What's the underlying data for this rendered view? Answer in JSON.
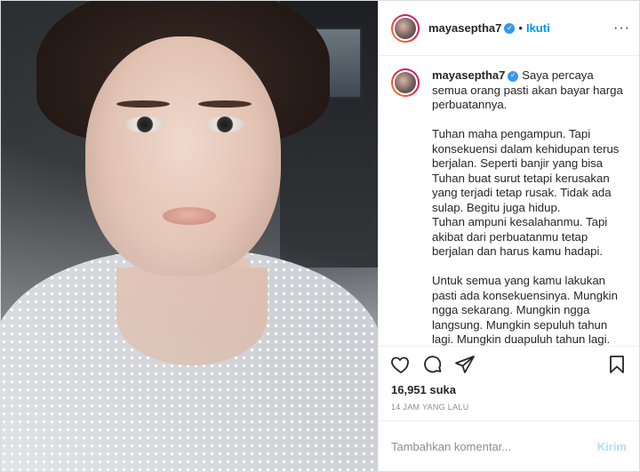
{
  "post": {
    "username": "mayaseptha7",
    "follow_label": "Ikuti",
    "dot_separator": "•",
    "more_label": "···",
    "caption": "Saya percaya semua orang pasti akan bayar harga perbuatannya.\n\nTuhan maha pengampun. Tapi konsekuensi dalam kehidupan terus berjalan. Seperti banjir yang bisa Tuhan buat surut tetapi kerusakan yang terjadi tetap rusak. Tidak ada sulap. Begitu juga hidup.\nTuhan ampuni kesalahanmu. Tapi akibat dari perbuatanmu tetap berjalan dan harus kamu hadapi.\n\nUntuk semua yang kamu lakukan pasti ada konsekuensinya. Mungkin ngga sekarang. Mungkin ngga langsung. Mungkin sepuluh tahun lagi. Mungkin duapuluh tahun lagi.",
    "likes": "16,951 suka",
    "timestamp": "14 JAM YANG LALU",
    "comment_placeholder": "Tambahkan komentar...",
    "post_button": "Kirim"
  },
  "icons": {
    "verified": "verified-badge-icon",
    "like": "heart-icon",
    "comment": "comment-bubble-icon",
    "share": "paper-plane-icon",
    "save": "bookmark-icon"
  },
  "colors": {
    "accent": "#0095f6",
    "verified": "#3897f0",
    "muted": "#8e8e8e",
    "border": "#dbdbdb"
  }
}
